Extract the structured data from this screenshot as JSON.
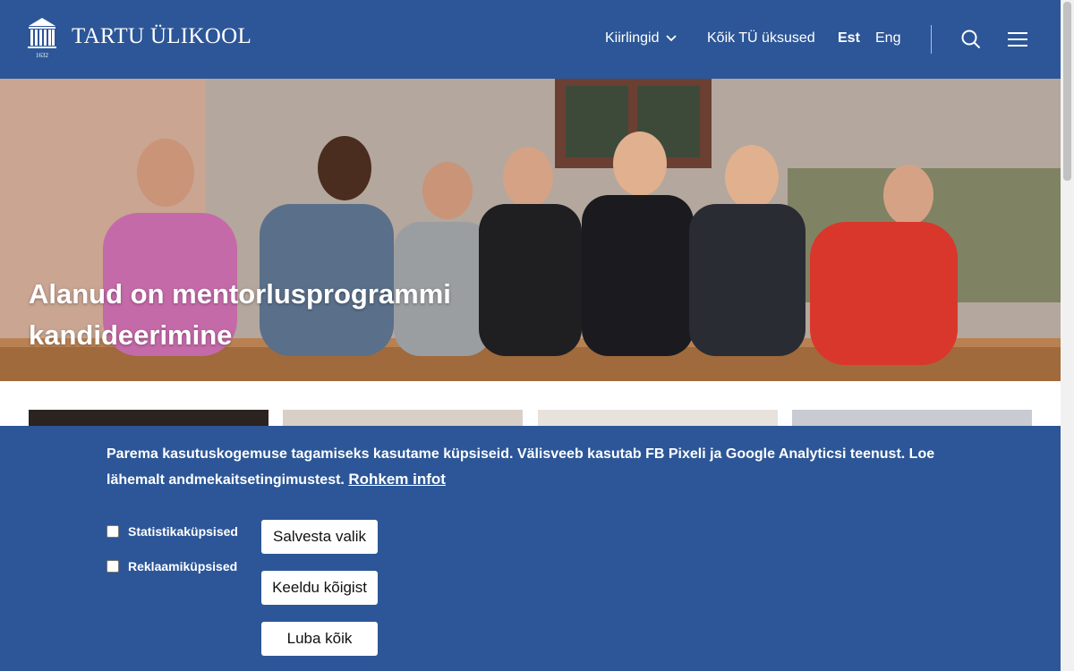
{
  "header": {
    "logo_text": "TARTU ÜLIKOOL",
    "logo_year": "1632",
    "nav": {
      "audiences_label": "Kiirlingid",
      "units_label": "Kõik TÜ üksused",
      "lang_est": "Est",
      "lang_eng": "Eng"
    }
  },
  "hero": {
    "title": "Alanud on mentorlusprogrammi kandideerimine"
  },
  "cookie_banner": {
    "message": "Parema kasutuskogemuse tagamiseks kasutame küpsiseid. Välisveeb kasutab FB Pixeli ja Google Analyticsi teenust. Loe lähemalt andmekaitsetingimustest.",
    "more_info_link": "Rohkem infot",
    "checkboxes": [
      {
        "label": "Statistikaküpsised",
        "checked": false
      },
      {
        "label": "Reklaamiküpsised",
        "checked": false
      }
    ],
    "buttons": {
      "save": "Salvesta valik",
      "reject": "Keeldu kõigist",
      "accept": "Luba kõik"
    }
  },
  "colors": {
    "brand_blue": "#2c5697",
    "text_white": "#ffffff"
  }
}
